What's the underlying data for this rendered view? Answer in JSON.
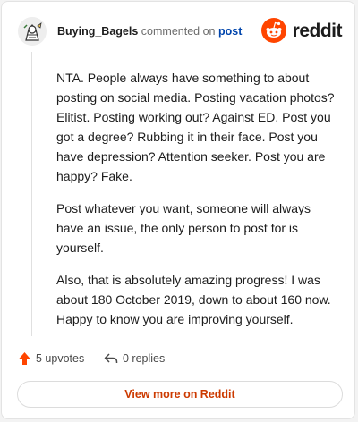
{
  "comment": {
    "username": "Buying_Bagels",
    "action": "commented on",
    "target": "post",
    "paragraphs": [
      "NTA. People always have something to about posting on social media. Posting vacation photos? Elitist. Posting working out? Against ED. Post you got a degree? Rubbing it in their face. Post you have depression? Attention seeker. Post you are happy? Fake.",
      "Post whatever you want, someone will always have an issue, the only person to post for is yourself.",
      "Also, that is absolutely amazing progress! I was about 180 October 2019, down to about 160 now. Happy to know you are improving yourself."
    ]
  },
  "brand": {
    "name": "reddit",
    "color": "#ff4500"
  },
  "footer": {
    "upvotes": "5 upvotes",
    "replies": "0 replies",
    "upvote_icon": "upvote-arrow-icon",
    "reply_icon": "reply-arrow-icon"
  },
  "cta": {
    "label": "View more on Reddit"
  }
}
